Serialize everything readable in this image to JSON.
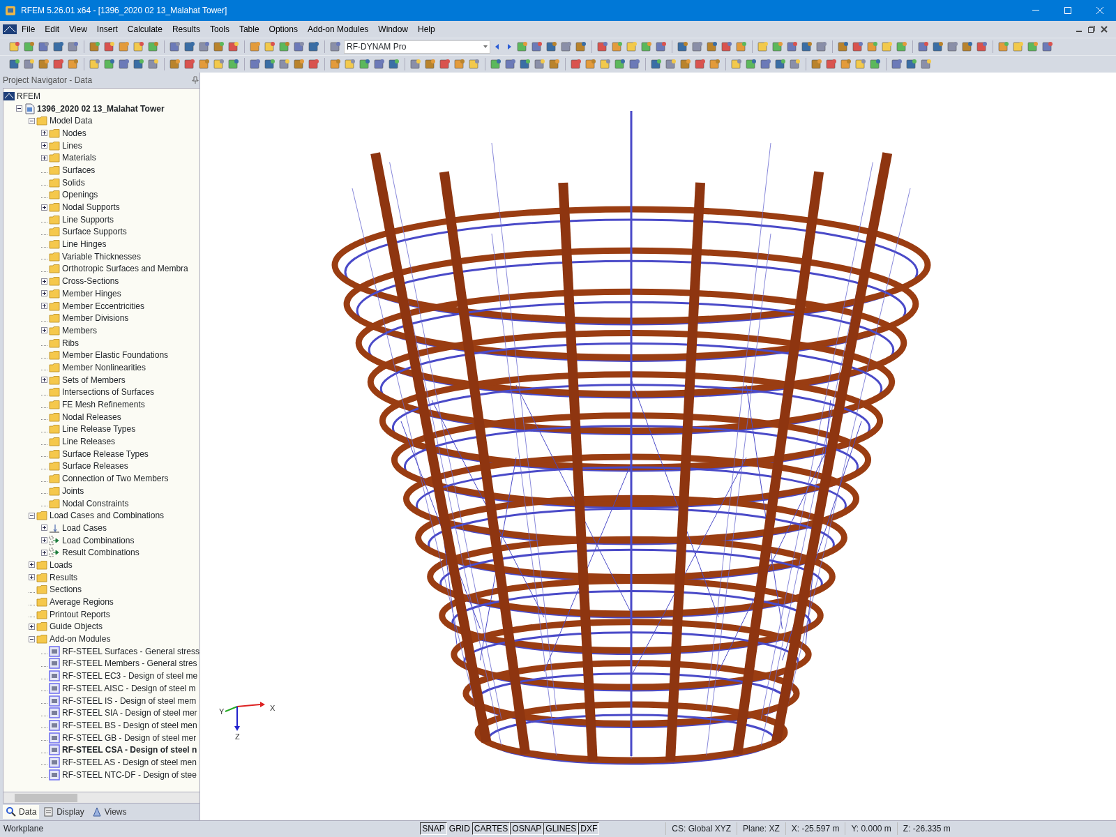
{
  "window": {
    "title": "RFEM 5.26.01 x64 - [1396_2020 02 13_Malahat Tower]"
  },
  "menu": [
    "File",
    "Edit",
    "View",
    "Insert",
    "Calculate",
    "Results",
    "Tools",
    "Table",
    "Options",
    "Add-on Modules",
    "Window",
    "Help"
  ],
  "module_combo": {
    "value": "RF-DYNAM Pro"
  },
  "navigator": {
    "title": "Project Navigator - Data",
    "tree": [
      {
        "label": "RFEM",
        "kind": "root",
        "children": [
          {
            "label": "1396_2020 02 13_Malahat Tower",
            "kind": "project",
            "bold": true,
            "expanded": true,
            "children": [
              {
                "label": "Model Data",
                "kind": "folder",
                "expanded": true,
                "children": [
                  {
                    "label": "Nodes",
                    "kind": "folder",
                    "expanded": false
                  },
                  {
                    "label": "Lines",
                    "kind": "folder",
                    "expanded": false
                  },
                  {
                    "label": "Materials",
                    "kind": "folder",
                    "expanded": false
                  },
                  {
                    "label": "Surfaces",
                    "kind": "folder"
                  },
                  {
                    "label": "Solids",
                    "kind": "folder"
                  },
                  {
                    "label": "Openings",
                    "kind": "folder"
                  },
                  {
                    "label": "Nodal Supports",
                    "kind": "folder",
                    "expanded": false
                  },
                  {
                    "label": "Line Supports",
                    "kind": "folder"
                  },
                  {
                    "label": "Surface Supports",
                    "kind": "folder"
                  },
                  {
                    "label": "Line Hinges",
                    "kind": "folder"
                  },
                  {
                    "label": "Variable Thicknesses",
                    "kind": "folder"
                  },
                  {
                    "label": "Orthotropic Surfaces and Membra",
                    "kind": "folder"
                  },
                  {
                    "label": "Cross-Sections",
                    "kind": "folder",
                    "expanded": false
                  },
                  {
                    "label": "Member Hinges",
                    "kind": "folder",
                    "expanded": false
                  },
                  {
                    "label": "Member Eccentricities",
                    "kind": "folder",
                    "expanded": false
                  },
                  {
                    "label": "Member Divisions",
                    "kind": "folder"
                  },
                  {
                    "label": "Members",
                    "kind": "folder",
                    "expanded": false
                  },
                  {
                    "label": "Ribs",
                    "kind": "folder"
                  },
                  {
                    "label": "Member Elastic Foundations",
                    "kind": "folder"
                  },
                  {
                    "label": "Member Nonlinearities",
                    "kind": "folder"
                  },
                  {
                    "label": "Sets of Members",
                    "kind": "folder",
                    "expanded": false
                  },
                  {
                    "label": "Intersections of Surfaces",
                    "kind": "folder"
                  },
                  {
                    "label": "FE Mesh Refinements",
                    "kind": "folder"
                  },
                  {
                    "label": "Nodal Releases",
                    "kind": "folder"
                  },
                  {
                    "label": "Line Release Types",
                    "kind": "folder"
                  },
                  {
                    "label": "Line Releases",
                    "kind": "folder"
                  },
                  {
                    "label": "Surface Release Types",
                    "kind": "folder"
                  },
                  {
                    "label": "Surface Releases",
                    "kind": "folder"
                  },
                  {
                    "label": "Connection of Two Members",
                    "kind": "folder"
                  },
                  {
                    "label": "Joints",
                    "kind": "folder"
                  },
                  {
                    "label": "Nodal Constraints",
                    "kind": "folder"
                  }
                ]
              },
              {
                "label": "Load Cases and Combinations",
                "kind": "folder",
                "expanded": true,
                "children": [
                  {
                    "label": "Load Cases",
                    "kind": "loadcase",
                    "expanded": false
                  },
                  {
                    "label": "Load Combinations",
                    "kind": "combination",
                    "expanded": false
                  },
                  {
                    "label": "Result Combinations",
                    "kind": "combination",
                    "expanded": false
                  }
                ]
              },
              {
                "label": "Loads",
                "kind": "folder",
                "expanded": false
              },
              {
                "label": "Results",
                "kind": "folder",
                "expanded": false
              },
              {
                "label": "Sections",
                "kind": "folder"
              },
              {
                "label": "Average Regions",
                "kind": "folder"
              },
              {
                "label": "Printout Reports",
                "kind": "folder"
              },
              {
                "label": "Guide Objects",
                "kind": "folder",
                "expanded": false
              },
              {
                "label": "Add-on Modules",
                "kind": "folder",
                "expanded": true,
                "children": [
                  {
                    "label": "RF-STEEL Surfaces - General stress",
                    "kind": "module"
                  },
                  {
                    "label": "RF-STEEL Members - General stres",
                    "kind": "module"
                  },
                  {
                    "label": "RF-STEEL EC3 - Design of steel me",
                    "kind": "module"
                  },
                  {
                    "label": "RF-STEEL AISC - Design of steel m",
                    "kind": "module"
                  },
                  {
                    "label": "RF-STEEL IS - Design of steel mem",
                    "kind": "module"
                  },
                  {
                    "label": "RF-STEEL SIA - Design of steel mer",
                    "kind": "module"
                  },
                  {
                    "label": "RF-STEEL BS - Design of steel men",
                    "kind": "module"
                  },
                  {
                    "label": "RF-STEEL GB - Design of steel mer",
                    "kind": "module"
                  },
                  {
                    "label": "RF-STEEL CSA - Design of steel n",
                    "kind": "module",
                    "bold": true
                  },
                  {
                    "label": "RF-STEEL AS - Design of steel men",
                    "kind": "module"
                  },
                  {
                    "label": "RF-STEEL NTC-DF - Design of stee",
                    "kind": "module"
                  }
                ]
              }
            ]
          }
        ]
      }
    ],
    "tabs": [
      {
        "label": "Data",
        "selected": true
      },
      {
        "label": "Display",
        "selected": false
      },
      {
        "label": "Views",
        "selected": false
      }
    ]
  },
  "viewport": {
    "axes": {
      "x": "X",
      "y": "Y",
      "z": "Z"
    }
  },
  "status_bar": {
    "left": "Workplane",
    "toggles": [
      {
        "label": "SNAP",
        "on": true
      },
      {
        "label": "GRID",
        "on": false
      },
      {
        "label": "CARTES",
        "on": true
      },
      {
        "label": "OSNAP",
        "on": true
      },
      {
        "label": "GLINES",
        "on": true
      },
      {
        "label": "DXF",
        "on": true
      }
    ],
    "fields": [
      "CS: Global XYZ",
      "Plane: XZ",
      "X:  -25.597 m",
      "Y:  0.000 m",
      "Z:  -26.335 m"
    ]
  }
}
